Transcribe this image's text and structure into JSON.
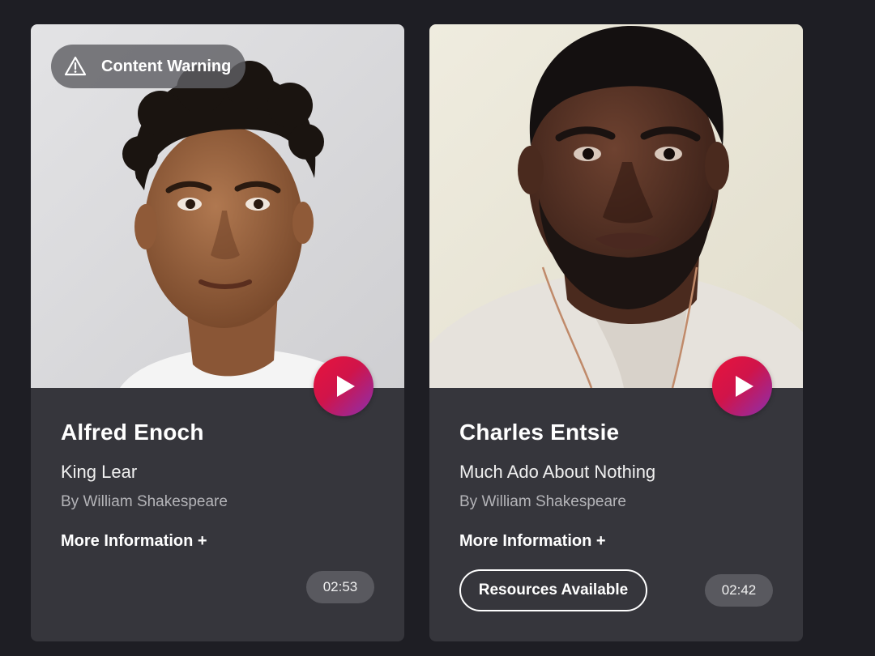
{
  "cards": [
    {
      "content_warning": "Content Warning",
      "name": "Alfred Enoch",
      "play": "King Lear",
      "author": "By William Shakespeare",
      "more_info": "More Information +",
      "duration": "02:53",
      "photo_bg": "#d8d8da"
    },
    {
      "name": "Charles Entsie",
      "play": "Much Ado About Nothing",
      "author": "By William Shakespeare",
      "more_info": "More Information +",
      "resources": "Resources Available",
      "duration": "02:42",
      "photo_bg": "#ece8da"
    }
  ],
  "colors": {
    "page_bg": "#1e1e24",
    "card_bg": "#36363c",
    "play_gradient_start": "#e8143c",
    "play_gradient_end": "#8a2fb0"
  },
  "icons": [
    "warning-icon",
    "play-icon"
  ]
}
